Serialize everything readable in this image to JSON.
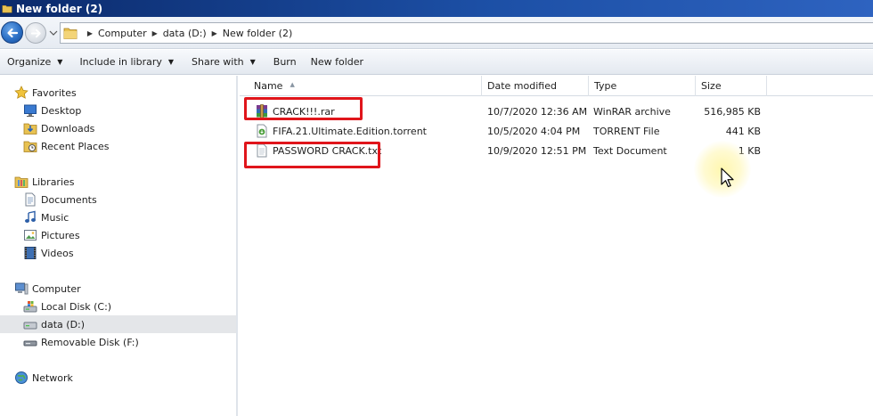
{
  "window": {
    "title": "New folder (2)"
  },
  "address": {
    "crumbs": [
      "Computer",
      "data (D:)",
      "New folder (2)"
    ]
  },
  "toolbar": {
    "organize": "Organize",
    "include_in_library": "Include in library",
    "share_with": "Share with",
    "burn": "Burn",
    "new_folder": "New folder"
  },
  "nav": {
    "favorites": "Favorites",
    "desktop": "Desktop",
    "downloads": "Downloads",
    "recent_places": "Recent Places",
    "libraries": "Libraries",
    "documents": "Documents",
    "music": "Music",
    "pictures": "Pictures",
    "videos": "Videos",
    "computer": "Computer",
    "local_disk_c": "Local Disk (C:)",
    "data_d": "data (D:)",
    "removable_f": "Removable Disk (F:)",
    "network": "Network",
    "selected": "data (D:)"
  },
  "columns": {
    "name": "Name",
    "date_modified": "Date modified",
    "type": "Type",
    "size": "Size"
  },
  "files": [
    {
      "name": "CRACK!!!.rar",
      "date": "10/7/2020 12:36 AM",
      "type": "WinRAR archive",
      "size": "516,985 KB",
      "icon": "winrar-archive-icon",
      "highlighted": true
    },
    {
      "name": "FIFA.21.Ultimate.Edition.torrent",
      "date": "10/5/2020 4:04 PM",
      "type": "TORRENT File",
      "size": "441 KB",
      "icon": "torrent-file-icon",
      "highlighted": false
    },
    {
      "name": "PASSWORD CRACK.txt",
      "date": "10/9/2020 12:51 PM",
      "type": "Text Document",
      "size": "1 KB",
      "icon": "text-document-icon",
      "highlighted": true
    }
  ],
  "colors": {
    "titlebar": "#1c4fa5",
    "highlight": "#e0151b",
    "selection": "#e4e6e9"
  }
}
